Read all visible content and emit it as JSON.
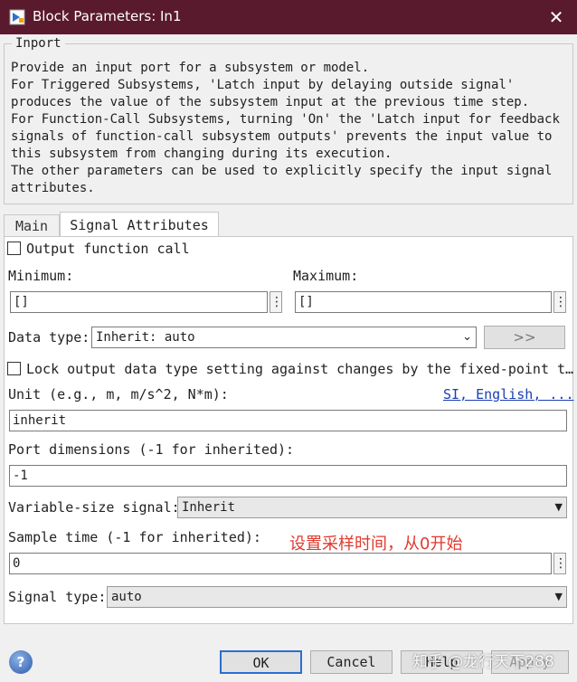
{
  "window": {
    "title": "Block Parameters: In1",
    "close_glyph": "✕"
  },
  "group": {
    "legend": "Inport",
    "description": "Provide an input port for a subsystem or model.\nFor Triggered Subsystems, 'Latch input by delaying outside signal'\nproduces the value of the subsystem input at the previous time step.\nFor Function-Call Subsystems, turning 'On' the 'Latch input for feedback\nsignals of function-call subsystem outputs' prevents the input value to\nthis subsystem from changing during its execution.\nThe other parameters can be used to explicitly specify the input signal\nattributes."
  },
  "tabs": [
    {
      "label": "Main",
      "active": false
    },
    {
      "label": "Signal Attributes",
      "active": true
    }
  ],
  "form": {
    "output_function_call": {
      "label": "Output function call",
      "checked": false
    },
    "minimum": {
      "label": "Minimum:",
      "value": "[]"
    },
    "maximum": {
      "label": "Maximum:",
      "value": "[]"
    },
    "data_type": {
      "label": "Data type:",
      "value": "Inherit: auto",
      "assistant_label": ">>"
    },
    "lock_output": {
      "label": "Lock output data type setting against changes by the fixed-point t…",
      "checked": false
    },
    "unit": {
      "label": "Unit (e.g., m, m/s^2, N*m):",
      "link": "SI, English, ...",
      "value": "inherit"
    },
    "port_dimensions": {
      "label": "Port dimensions (-1 for inherited):",
      "value": "-1"
    },
    "variable_size": {
      "label": "Variable-size signal:",
      "value": "Inherit"
    },
    "sample_time": {
      "label": "Sample time (-1 for inherited):",
      "value": "0"
    },
    "signal_type": {
      "label": "Signal type:",
      "value": "auto"
    }
  },
  "annotation": "设置采样时间，从0开始",
  "buttons": {
    "ok": "OK",
    "cancel": "Cancel",
    "help": "Help",
    "apply": "Apply"
  },
  "watermark": "知乎 @龙行天下288",
  "icons": {
    "help": "?",
    "dropdown": "▼",
    "ellipsis": "⋮"
  }
}
